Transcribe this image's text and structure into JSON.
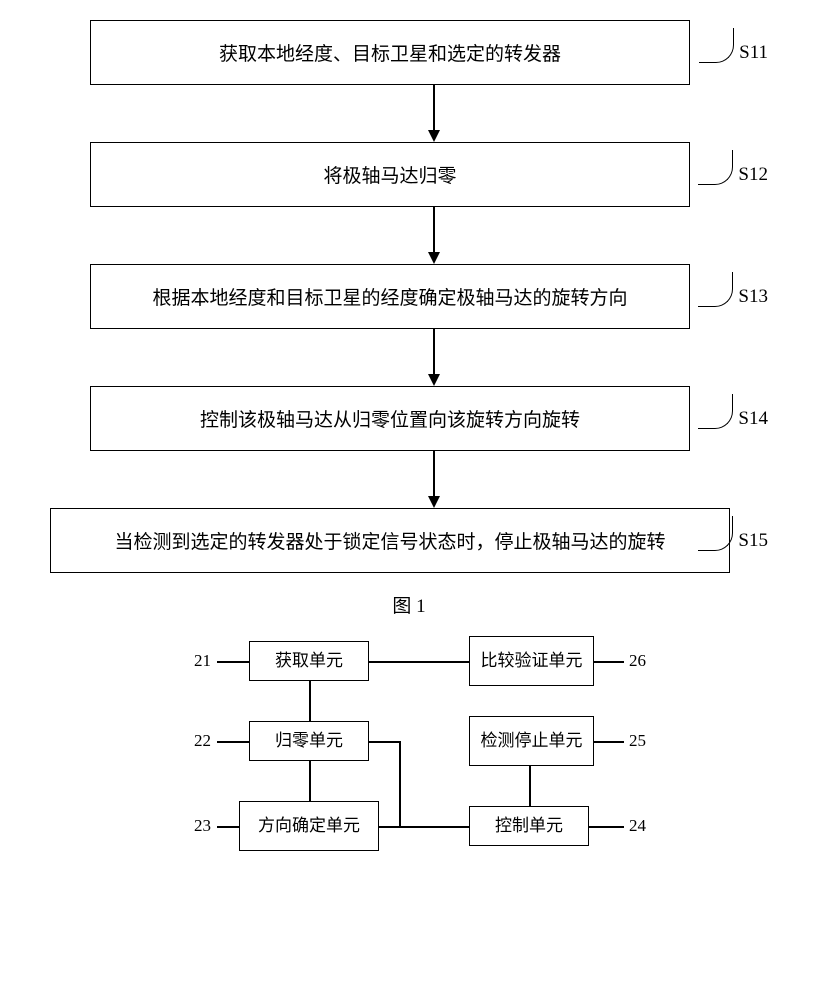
{
  "flowchart": {
    "steps": [
      {
        "id": "S11",
        "text": "获取本地经度、目标卫星和选定的转发器"
      },
      {
        "id": "S12",
        "text": "将极轴马达归零"
      },
      {
        "id": "S13",
        "text": "根据本地经度和目标卫星的经度确定极轴马达的旋转方向"
      },
      {
        "id": "S14",
        "text": "控制该极轴马达从归零位置向该旋转方向旋转"
      },
      {
        "id": "S15",
        "text": "当检测到选定的转发器处于锁定信号状态时，停止极轴马达的旋转"
      }
    ],
    "figure_label": "图 1"
  },
  "block_diagram": {
    "blocks": {
      "b21": {
        "num": "21",
        "text": "获取单元"
      },
      "b22": {
        "num": "22",
        "text": "归零单元"
      },
      "b23": {
        "num": "23",
        "text": "方向确定单元"
      },
      "b24": {
        "num": "24",
        "text": "控制单元"
      },
      "b25": {
        "num": "25",
        "text": "检测停止单元"
      },
      "b26": {
        "num": "26",
        "text": "比较验证单元"
      }
    }
  }
}
